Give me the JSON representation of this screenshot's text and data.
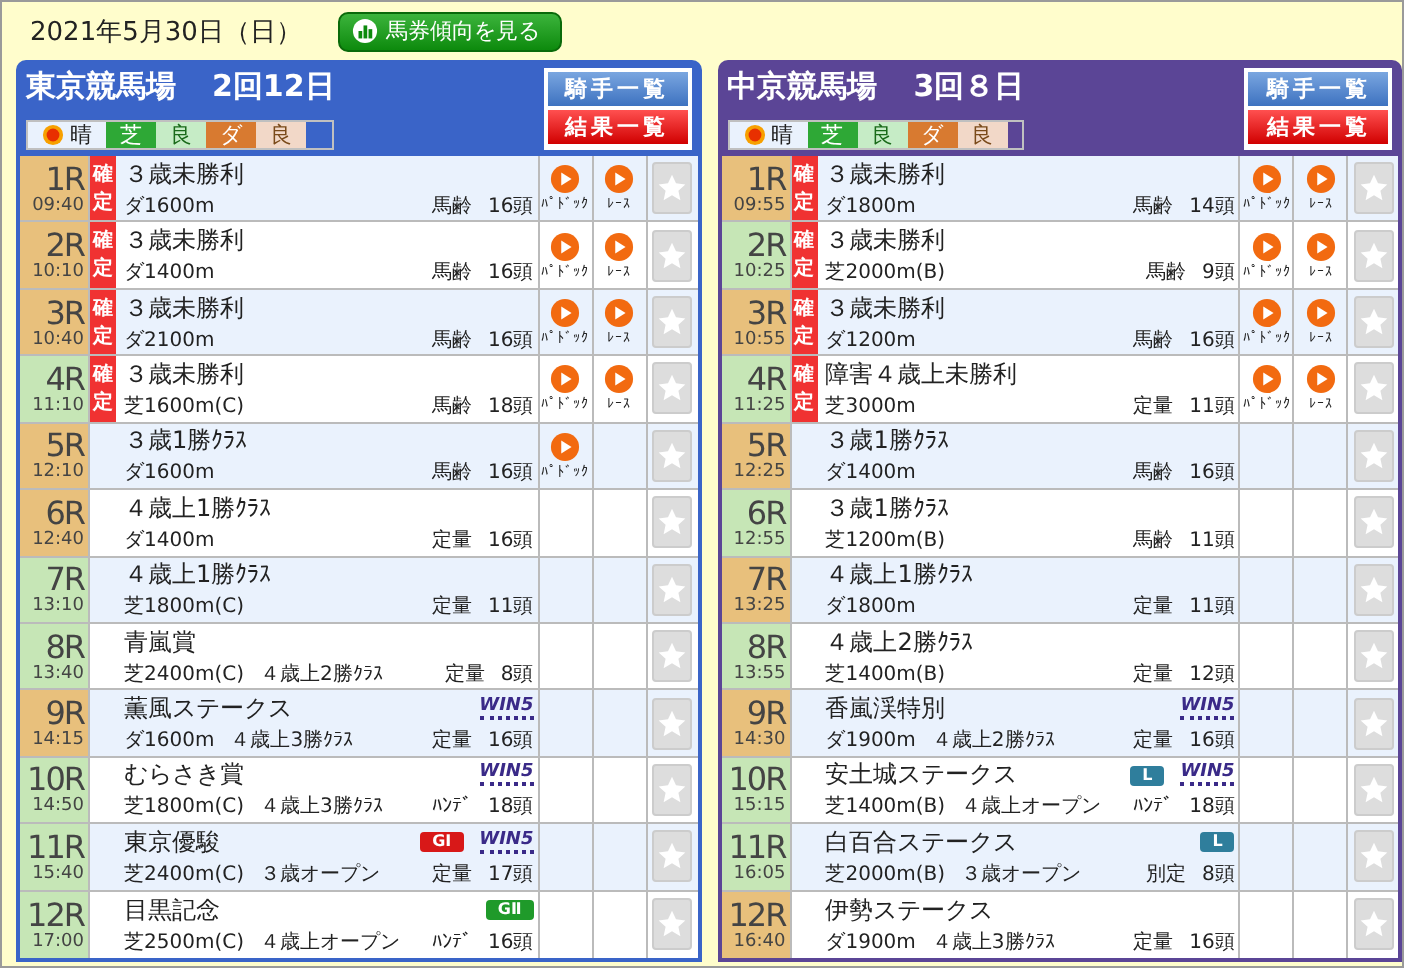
{
  "date": "2021年5月30日（日）",
  "trend_button": "馬券傾向を見る",
  "venues": [
    {
      "name": "東京競馬場",
      "meeting": "2回12日",
      "color": "#3a64c8",
      "weather": "晴",
      "turf_label": "芝",
      "turf_condition": "良",
      "dirt_label": "ダ",
      "dirt_condition": "良",
      "buttons": [
        "騎手一覧",
        "結果一覧"
      ],
      "races": [
        {
          "number": "1R",
          "time": "09:40",
          "color": "#e8c07c",
          "confirmed": true,
          "status": "確定",
          "name": "３歳未勝利",
          "course": "ダ1600m",
          "condition": "馬齢",
          "runners": "16頭",
          "videos": [
            "ﾊﾟﾄﾞｯｸ",
            "ﾚｰｽ"
          ]
        },
        {
          "number": "2R",
          "time": "10:10",
          "color": "#e8c07c",
          "confirmed": true,
          "status": "確定",
          "name": "３歳未勝利",
          "course": "ダ1400m",
          "condition": "馬齢",
          "runners": "16頭",
          "videos": [
            "ﾊﾟﾄﾞｯｸ",
            "ﾚｰｽ"
          ]
        },
        {
          "number": "3R",
          "time": "10:40",
          "color": "#e8c07c",
          "confirmed": true,
          "status": "確定",
          "name": "３歳未勝利",
          "course": "ダ2100m",
          "condition": "馬齢",
          "runners": "16頭",
          "videos": [
            "ﾊﾟﾄﾞｯｸ",
            "ﾚｰｽ"
          ]
        },
        {
          "number": "4R",
          "time": "11:10",
          "color": "#c6e6b6",
          "confirmed": true,
          "status": "確定",
          "name": "３歳未勝利",
          "course": "芝1600m(C)",
          "condition": "馬齢",
          "runners": "18頭",
          "videos": [
            "ﾊﾟﾄﾞｯｸ",
            "ﾚｰｽ"
          ]
        },
        {
          "number": "5R",
          "time": "12:10",
          "color": "#e8c07c",
          "confirmed": false,
          "name": "３歳1勝ｸﾗｽ",
          "course": "ダ1600m",
          "condition": "馬齢",
          "runners": "16頭",
          "videos": [
            "ﾊﾟﾄﾞｯｸ"
          ]
        },
        {
          "number": "6R",
          "time": "12:40",
          "color": "#e8c07c",
          "confirmed": false,
          "name": "４歳上1勝ｸﾗｽ",
          "course": "ダ1400m",
          "condition": "定量",
          "runners": "16頭"
        },
        {
          "number": "7R",
          "time": "13:10",
          "color": "#c6e6b6",
          "confirmed": false,
          "name": "４歳上1勝ｸﾗｽ",
          "course": "芝1800m(C)",
          "condition": "定量",
          "runners": "11頭"
        },
        {
          "number": "8R",
          "time": "13:40",
          "color": "#c6e6b6",
          "confirmed": false,
          "name": "青嵐賞",
          "course": "芝2400m(C)",
          "class": "４歳上2勝ｸﾗｽ",
          "condition": "定量",
          "runners": "8頭"
        },
        {
          "number": "9R",
          "time": "14:15",
          "color": "#e8c07c",
          "confirmed": false,
          "name": "薫風ステークス",
          "course": "ダ1600m",
          "class": "４歳上3勝ｸﾗｽ",
          "condition": "定量",
          "runners": "16頭",
          "badges": [
            {
              "kind": "win5",
              "text": "WIN5"
            }
          ]
        },
        {
          "number": "10R",
          "time": "14:50",
          "color": "#c6e6b6",
          "confirmed": false,
          "name": "むらさき賞",
          "course": "芝1800m(C)",
          "class": "４歳上3勝ｸﾗｽ",
          "condition": "ﾊﾝﾃﾞ",
          "runners": "18頭",
          "badges": [
            {
              "kind": "win5",
              "text": "WIN5"
            }
          ]
        },
        {
          "number": "11R",
          "time": "15:40",
          "color": "#c6e6b6",
          "confirmed": false,
          "name": "東京優駿",
          "course": "芝2400m(C)",
          "class": "３歳オープン",
          "condition": "定量",
          "runners": "17頭",
          "badges": [
            {
              "kind": "g1",
              "text": "GⅠ"
            },
            {
              "kind": "win5",
              "text": "WIN5"
            }
          ]
        },
        {
          "number": "12R",
          "time": "17:00",
          "color": "#c6e6b6",
          "confirmed": false,
          "name": "目黒記念",
          "course": "芝2500m(C)",
          "class": "４歳上オープン",
          "condition": "ﾊﾝﾃﾞ",
          "runners": "16頭",
          "badges": [
            {
              "kind": "g2",
              "text": "GⅡ"
            }
          ]
        }
      ]
    },
    {
      "name": "中京競馬場",
      "meeting": "3回８日",
      "color": "#5b4596",
      "weather": "晴",
      "turf_label": "芝",
      "turf_condition": "良",
      "dirt_label": "ダ",
      "dirt_condition": "良",
      "buttons": [
        "騎手一覧",
        "結果一覧"
      ],
      "races": [
        {
          "number": "1R",
          "time": "09:55",
          "color": "#e8c07c",
          "confirmed": true,
          "status": "確定",
          "name": "３歳未勝利",
          "course": "ダ1800m",
          "condition": "馬齢",
          "runners": "14頭",
          "videos": [
            "ﾊﾟﾄﾞｯｸ",
            "ﾚｰｽ"
          ]
        },
        {
          "number": "2R",
          "time": "10:25",
          "color": "#c6e6b6",
          "confirmed": true,
          "status": "確定",
          "name": "３歳未勝利",
          "course": "芝2000m(B)",
          "condition": "馬齢",
          "runners": "9頭",
          "videos": [
            "ﾊﾟﾄﾞｯｸ",
            "ﾚｰｽ"
          ]
        },
        {
          "number": "3R",
          "time": "10:55",
          "color": "#e8c07c",
          "confirmed": true,
          "status": "確定",
          "name": "３歳未勝利",
          "course": "ダ1200m",
          "condition": "馬齢",
          "runners": "16頭",
          "videos": [
            "ﾊﾟﾄﾞｯｸ",
            "ﾚｰｽ"
          ]
        },
        {
          "number": "4R",
          "time": "11:25",
          "color": "#c6e6b6",
          "confirmed": true,
          "status": "確定",
          "name": "障害４歳上未勝利",
          "course": "芝3000m",
          "condition": "定量",
          "runners": "11頭",
          "videos": [
            "ﾊﾟﾄﾞｯｸ",
            "ﾚｰｽ"
          ]
        },
        {
          "number": "5R",
          "time": "12:25",
          "color": "#e8c07c",
          "confirmed": false,
          "name": "３歳1勝ｸﾗｽ",
          "course": "ダ1400m",
          "condition": "馬齢",
          "runners": "16頭"
        },
        {
          "number": "6R",
          "time": "12:55",
          "color": "#c6e6b6",
          "confirmed": false,
          "name": "３歳1勝ｸﾗｽ",
          "course": "芝1200m(B)",
          "condition": "馬齢",
          "runners": "11頭"
        },
        {
          "number": "7R",
          "time": "13:25",
          "color": "#e8c07c",
          "confirmed": false,
          "name": "４歳上1勝ｸﾗｽ",
          "course": "ダ1800m",
          "condition": "定量",
          "runners": "11頭"
        },
        {
          "number": "8R",
          "time": "13:55",
          "color": "#c6e6b6",
          "confirmed": false,
          "name": "４歳上2勝ｸﾗｽ",
          "course": "芝1400m(B)",
          "condition": "定量",
          "runners": "12頭"
        },
        {
          "number": "9R",
          "time": "14:30",
          "color": "#e8c07c",
          "confirmed": false,
          "name": "香嵐渓特別",
          "course": "ダ1900m",
          "class": "４歳上2勝ｸﾗｽ",
          "condition": "定量",
          "runners": "16頭",
          "badges": [
            {
              "kind": "win5",
              "text": "WIN5"
            }
          ]
        },
        {
          "number": "10R",
          "time": "15:15",
          "color": "#c6e6b6",
          "confirmed": false,
          "name": "安土城ステークス",
          "course": "芝1400m(B)",
          "class": "４歳上オープン",
          "condition": "ﾊﾝﾃﾞ",
          "runners": "18頭",
          "badges": [
            {
              "kind": "listed",
              "text": "L"
            },
            {
              "kind": "win5",
              "text": "WIN5"
            }
          ]
        },
        {
          "number": "11R",
          "time": "16:05",
          "color": "#c6e6b6",
          "confirmed": false,
          "name": "白百合ステークス",
          "course": "芝2000m(B)",
          "class": "３歳オープン",
          "condition": "別定",
          "runners": "8頭",
          "badges": [
            {
              "kind": "listed",
              "text": "L"
            }
          ]
        },
        {
          "number": "12R",
          "time": "16:40",
          "color": "#e8c07c",
          "confirmed": false,
          "name": "伊勢ステークス",
          "course": "ダ1900m",
          "class": "４歳上3勝ｸﾗｽ",
          "condition": "定量",
          "runners": "16頭"
        }
      ]
    }
  ]
}
